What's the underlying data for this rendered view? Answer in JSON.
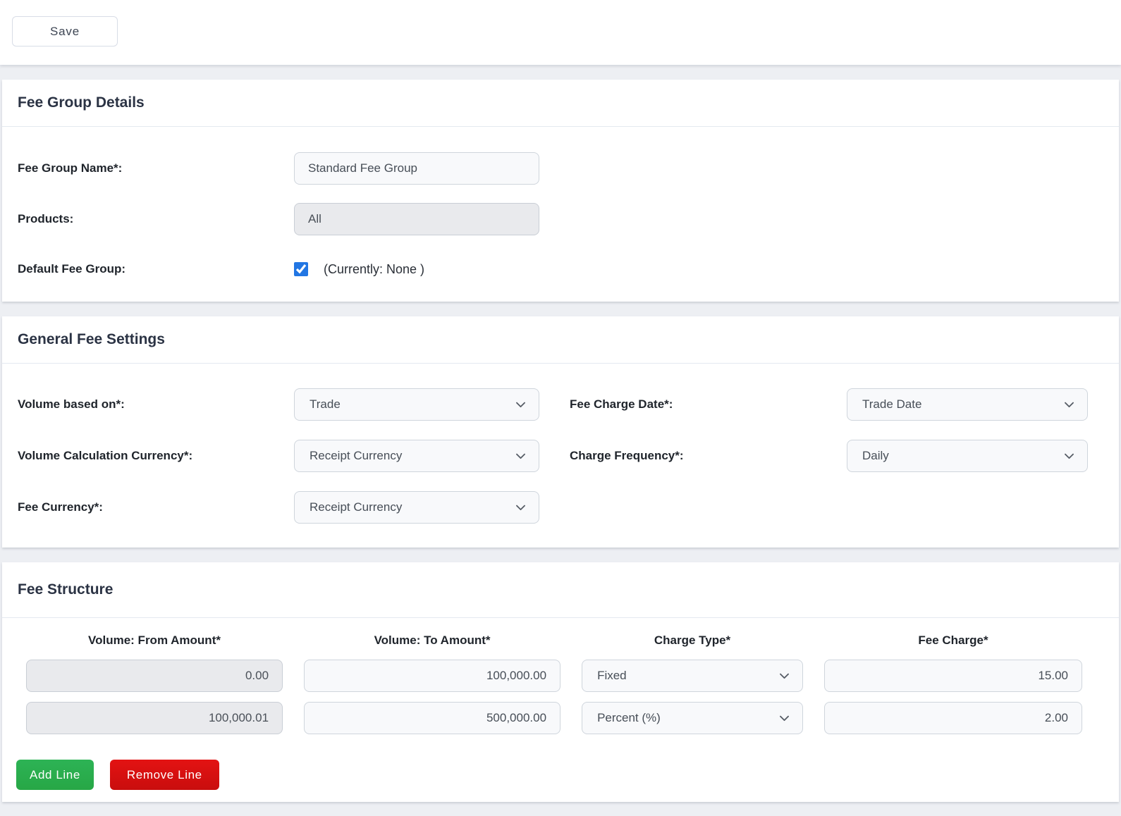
{
  "toolbar": {
    "save_label": "Save"
  },
  "fee_group_details": {
    "title": "Fee Group Details",
    "name_label": "Fee Group Name*:",
    "name_value": "Standard Fee Group",
    "products_label": "Products:",
    "products_value": "All",
    "default_label": "Default Fee Group:",
    "default_checked": true,
    "default_note": "(Currently: None )"
  },
  "general_fee_settings": {
    "title": "General Fee Settings",
    "volume_based_on_label": "Volume based on*:",
    "volume_based_on_value": "Trade",
    "volume_calc_currency_label": "Volume Calculation Currency*:",
    "volume_calc_currency_value": "Receipt Currency",
    "fee_currency_label": "Fee Currency*:",
    "fee_currency_value": "Receipt Currency",
    "fee_charge_date_label": "Fee Charge Date*:",
    "fee_charge_date_value": "Trade Date",
    "charge_frequency_label": "Charge Frequency*:",
    "charge_frequency_value": "Daily"
  },
  "fee_structure": {
    "title": "Fee Structure",
    "columns": [
      "Volume: From Amount*",
      "Volume: To Amount*",
      "Charge Type*",
      "Fee Charge*"
    ],
    "rows": [
      {
        "from_amount": "0.00",
        "to_amount": "100,000.00",
        "charge_type": "Fixed",
        "fee_charge": "15.00"
      },
      {
        "from_amount": "100,000.01",
        "to_amount": "500,000.00",
        "charge_type": "Percent (%)",
        "fee_charge": "2.00"
      }
    ],
    "add_line_label": "Add Line",
    "remove_line_label": "Remove Line"
  },
  "colors": {
    "checkbox_accent": "#2276e3",
    "add_button_green": "#28ad4c",
    "remove_button_red": "#d90f0f"
  }
}
